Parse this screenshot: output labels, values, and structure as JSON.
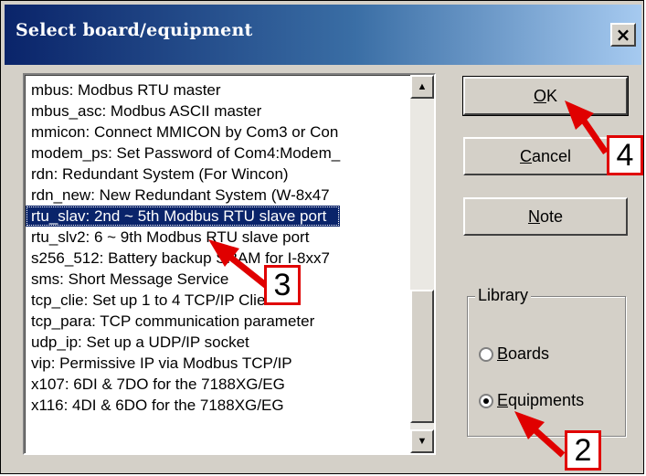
{
  "dialog": {
    "title": "Select board/equipment",
    "close_glyph": "×"
  },
  "list": {
    "items": [
      "mbus: Modbus RTU master",
      "mbus_asc: Modbus ASCII master",
      "mmicon: Connect MMICON by Com3 or Con",
      "modem_ps: Set Password of Com4:Modem_",
      "rdn: Redundant System (For Wincon)",
      "rdn_new: New Redundant System (W-8x47",
      "rtu_slav: 2nd ~ 5th Modbus RTU slave port",
      "rtu_slv2: 6 ~ 9th Modbus RTU slave port",
      "s256_512: Battery backup SRAM for I-8xx7",
      "sms: Short Message Service",
      "tcp_clie: Set up 1 to 4 TCP/IP Client",
      "tcp_para: TCP communication parameter",
      "udp_ip: Set up a UDP/IP socket",
      "vip: Permissive IP via Modbus TCP/IP",
      "x107: 6DI & 7DO for the 7188XG/EG",
      "x116: 4DI & 6DO for the 7188XG/EG"
    ],
    "selected_index": 6
  },
  "buttons": {
    "ok": {
      "underline": "O",
      "rest": "K"
    },
    "cancel": {
      "underline": "C",
      "rest": "ancel"
    },
    "note": {
      "underline": "N",
      "rest": "ote"
    }
  },
  "library": {
    "label": "Library",
    "boards": {
      "underline": "B",
      "rest": "oards",
      "checked": false
    },
    "equipments": {
      "underline": "E",
      "rest": "quipments",
      "checked": true
    }
  },
  "callouts": {
    "step2": "2",
    "step3": "3",
    "step4": "4"
  },
  "colors": {
    "title_gradient_start": "#0a246a",
    "selection": "#0a246a",
    "annotation_red": "#e00000"
  }
}
